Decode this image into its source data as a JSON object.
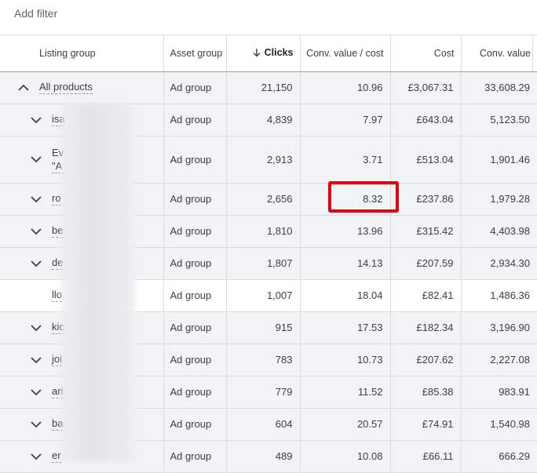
{
  "toolbar": {
    "add_filter_label": "Add filter"
  },
  "table": {
    "headers": {
      "listing_group": "Listing group",
      "asset_group": "Asset group",
      "clicks": "Clicks",
      "conv_value_cost": "Conv. value / cost",
      "cost": "Cost",
      "conv_value": "Conv. value"
    },
    "sort": {
      "column": "clicks",
      "direction": "descending",
      "icon": "arrow-down-icon"
    },
    "rows": [
      {
        "listing_group": "All products",
        "asset_group": "Ad group",
        "clicks": "21,150",
        "conv_value_cost": "10.96",
        "cost": "£3,067.31",
        "conv_value": "33,608.29",
        "expand_icon": "chevron-up-icon"
      },
      {
        "listing_group": "isa",
        "asset_group": "Ad group",
        "clicks": "4,839",
        "conv_value_cost": "7.97",
        "cost": "£643.04",
        "conv_value": "5,123.50",
        "expand_icon": "chevron-down-icon"
      },
      {
        "listing_group": "Ev\n\"A",
        "asset_group": "Ad group",
        "clicks": "2,913",
        "conv_value_cost": "3.71",
        "cost": "£513.04",
        "conv_value": "1,901.46",
        "expand_icon": "chevron-down-icon"
      },
      {
        "listing_group": "ro",
        "asset_group": "Ad group",
        "clicks": "2,656",
        "conv_value_cost": "8.32",
        "cost": "£237.86",
        "conv_value": "1,979.28",
        "expand_icon": "chevron-down-icon"
      },
      {
        "listing_group": "be",
        "asset_group": "Ad group",
        "clicks": "1,810",
        "conv_value_cost": "13.96",
        "cost": "£315.42",
        "conv_value": "4,403.98",
        "expand_icon": "chevron-down-icon"
      },
      {
        "listing_group": "de",
        "asset_group": "Ad group",
        "clicks": "1,807",
        "conv_value_cost": "14.13",
        "cost": "£207.59",
        "conv_value": "2,934.30",
        "expand_icon": "chevron-down-icon"
      },
      {
        "listing_group": "llo",
        "asset_group": "Ad group",
        "clicks": "1,007",
        "conv_value_cost": "18.04",
        "cost": "£82.41",
        "conv_value": "1,486.36",
        "expand_icon": ""
      },
      {
        "listing_group": "kic",
        "asset_group": "Ad group",
        "clicks": "915",
        "conv_value_cost": "17.53",
        "cost": "£182.34",
        "conv_value": "3,196.90",
        "expand_icon": "chevron-down-icon"
      },
      {
        "listing_group": "joi",
        "asset_group": "Ad group",
        "clicks": "783",
        "conv_value_cost": "10.73",
        "cost": "£207.62",
        "conv_value": "2,227.08",
        "expand_icon": "chevron-down-icon"
      },
      {
        "listing_group": "ari",
        "asset_group": "Ad group",
        "clicks": "779",
        "conv_value_cost": "11.52",
        "cost": "£85.38",
        "conv_value": "983.91",
        "expand_icon": "chevron-down-icon"
      },
      {
        "listing_group": "ba",
        "asset_group": "Ad group",
        "clicks": "604",
        "conv_value_cost": "20.57",
        "cost": "£74.91",
        "conv_value": "1,540.98",
        "expand_icon": "chevron-down-icon"
      },
      {
        "listing_group": "er",
        "asset_group": "Ad group",
        "clicks": "489",
        "conv_value_cost": "10.08",
        "cost": "£66.11",
        "conv_value": "666.29",
        "expand_icon": "chevron-down-icon"
      }
    ]
  },
  "annotation": {
    "highlight_color": "#e60012",
    "highlighted_cell": "8.32"
  },
  "colors": {
    "row_background": "#f1f3f4",
    "selected_row_background": "#ffffff",
    "border": "#dadce0"
  }
}
